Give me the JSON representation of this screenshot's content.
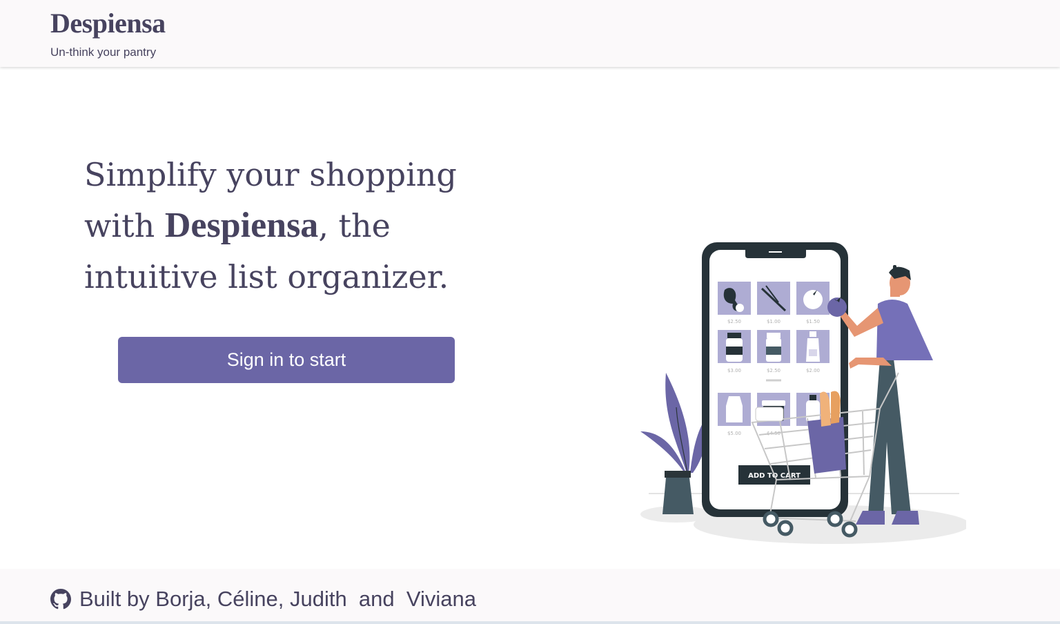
{
  "header": {
    "brand": "Despiensa",
    "tagline": "Un-think your pantry"
  },
  "hero": {
    "line1": "Simplify your shopping",
    "line2_prefix": "with ",
    "line2_brand": "Despiensa",
    "line2_suffix": ", the",
    "line3": "intuitive list organizer.",
    "cta_label": "Sign in to start"
  },
  "illustration": {
    "prices": [
      "$2.50",
      "$1.00",
      "$1.50",
      "$3.00",
      "$2.50",
      "$2.00",
      "$5.00",
      "$4.50"
    ],
    "add_to_cart": "ADD TO CART"
  },
  "footer": {
    "icon": "github-icon",
    "credits": "Built by Borja, Céline, Judith  and  Viviana"
  },
  "colors": {
    "accent": "#6b66a6",
    "text": "#47435f",
    "header_bg": "#fbf9fa",
    "dark": "#2b3539"
  }
}
